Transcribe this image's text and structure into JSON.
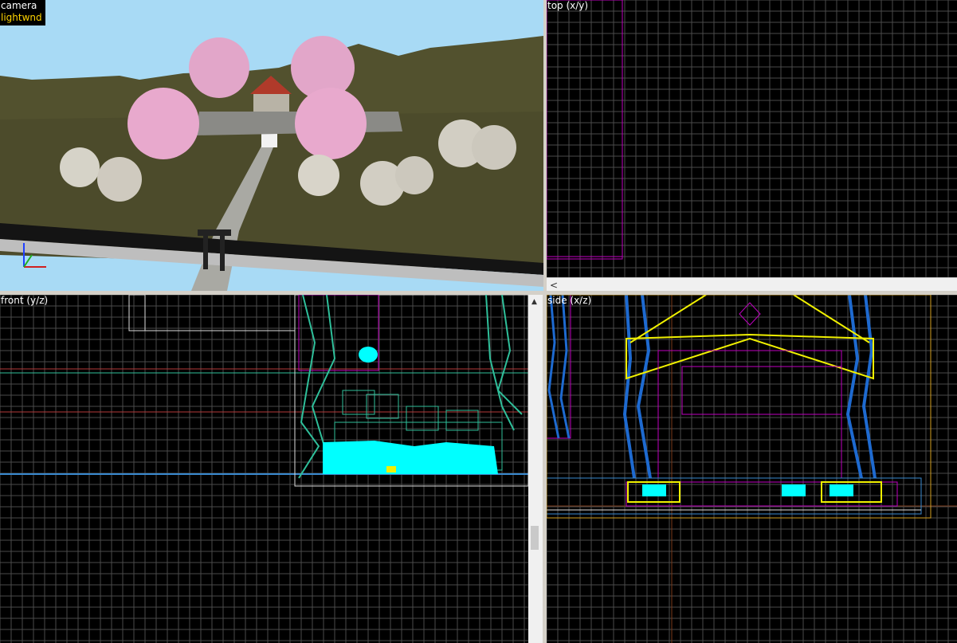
{
  "viewports": {
    "camera": {
      "title": "camera",
      "mode": "lightwnd"
    },
    "top": {
      "title": "top (x/y)"
    },
    "front": {
      "title": "front (y/z)"
    },
    "side": {
      "title": "side (x/z)"
    }
  },
  "scrollbars": {
    "top_hscroll_arrow": "<",
    "front_vscroll_up": "▲"
  },
  "colors": {
    "grid": "#4a4a4a",
    "grid_major": "#7a3a1a",
    "sky": "#a8daf5",
    "ground": "#4b4b2c",
    "wire_cyan": "#00ffff",
    "wire_magenta": "#c000c0",
    "wire_yellow": "#f0f000",
    "wire_blue": "#1e6ad0",
    "wire_teal": "#2fbf9a"
  }
}
